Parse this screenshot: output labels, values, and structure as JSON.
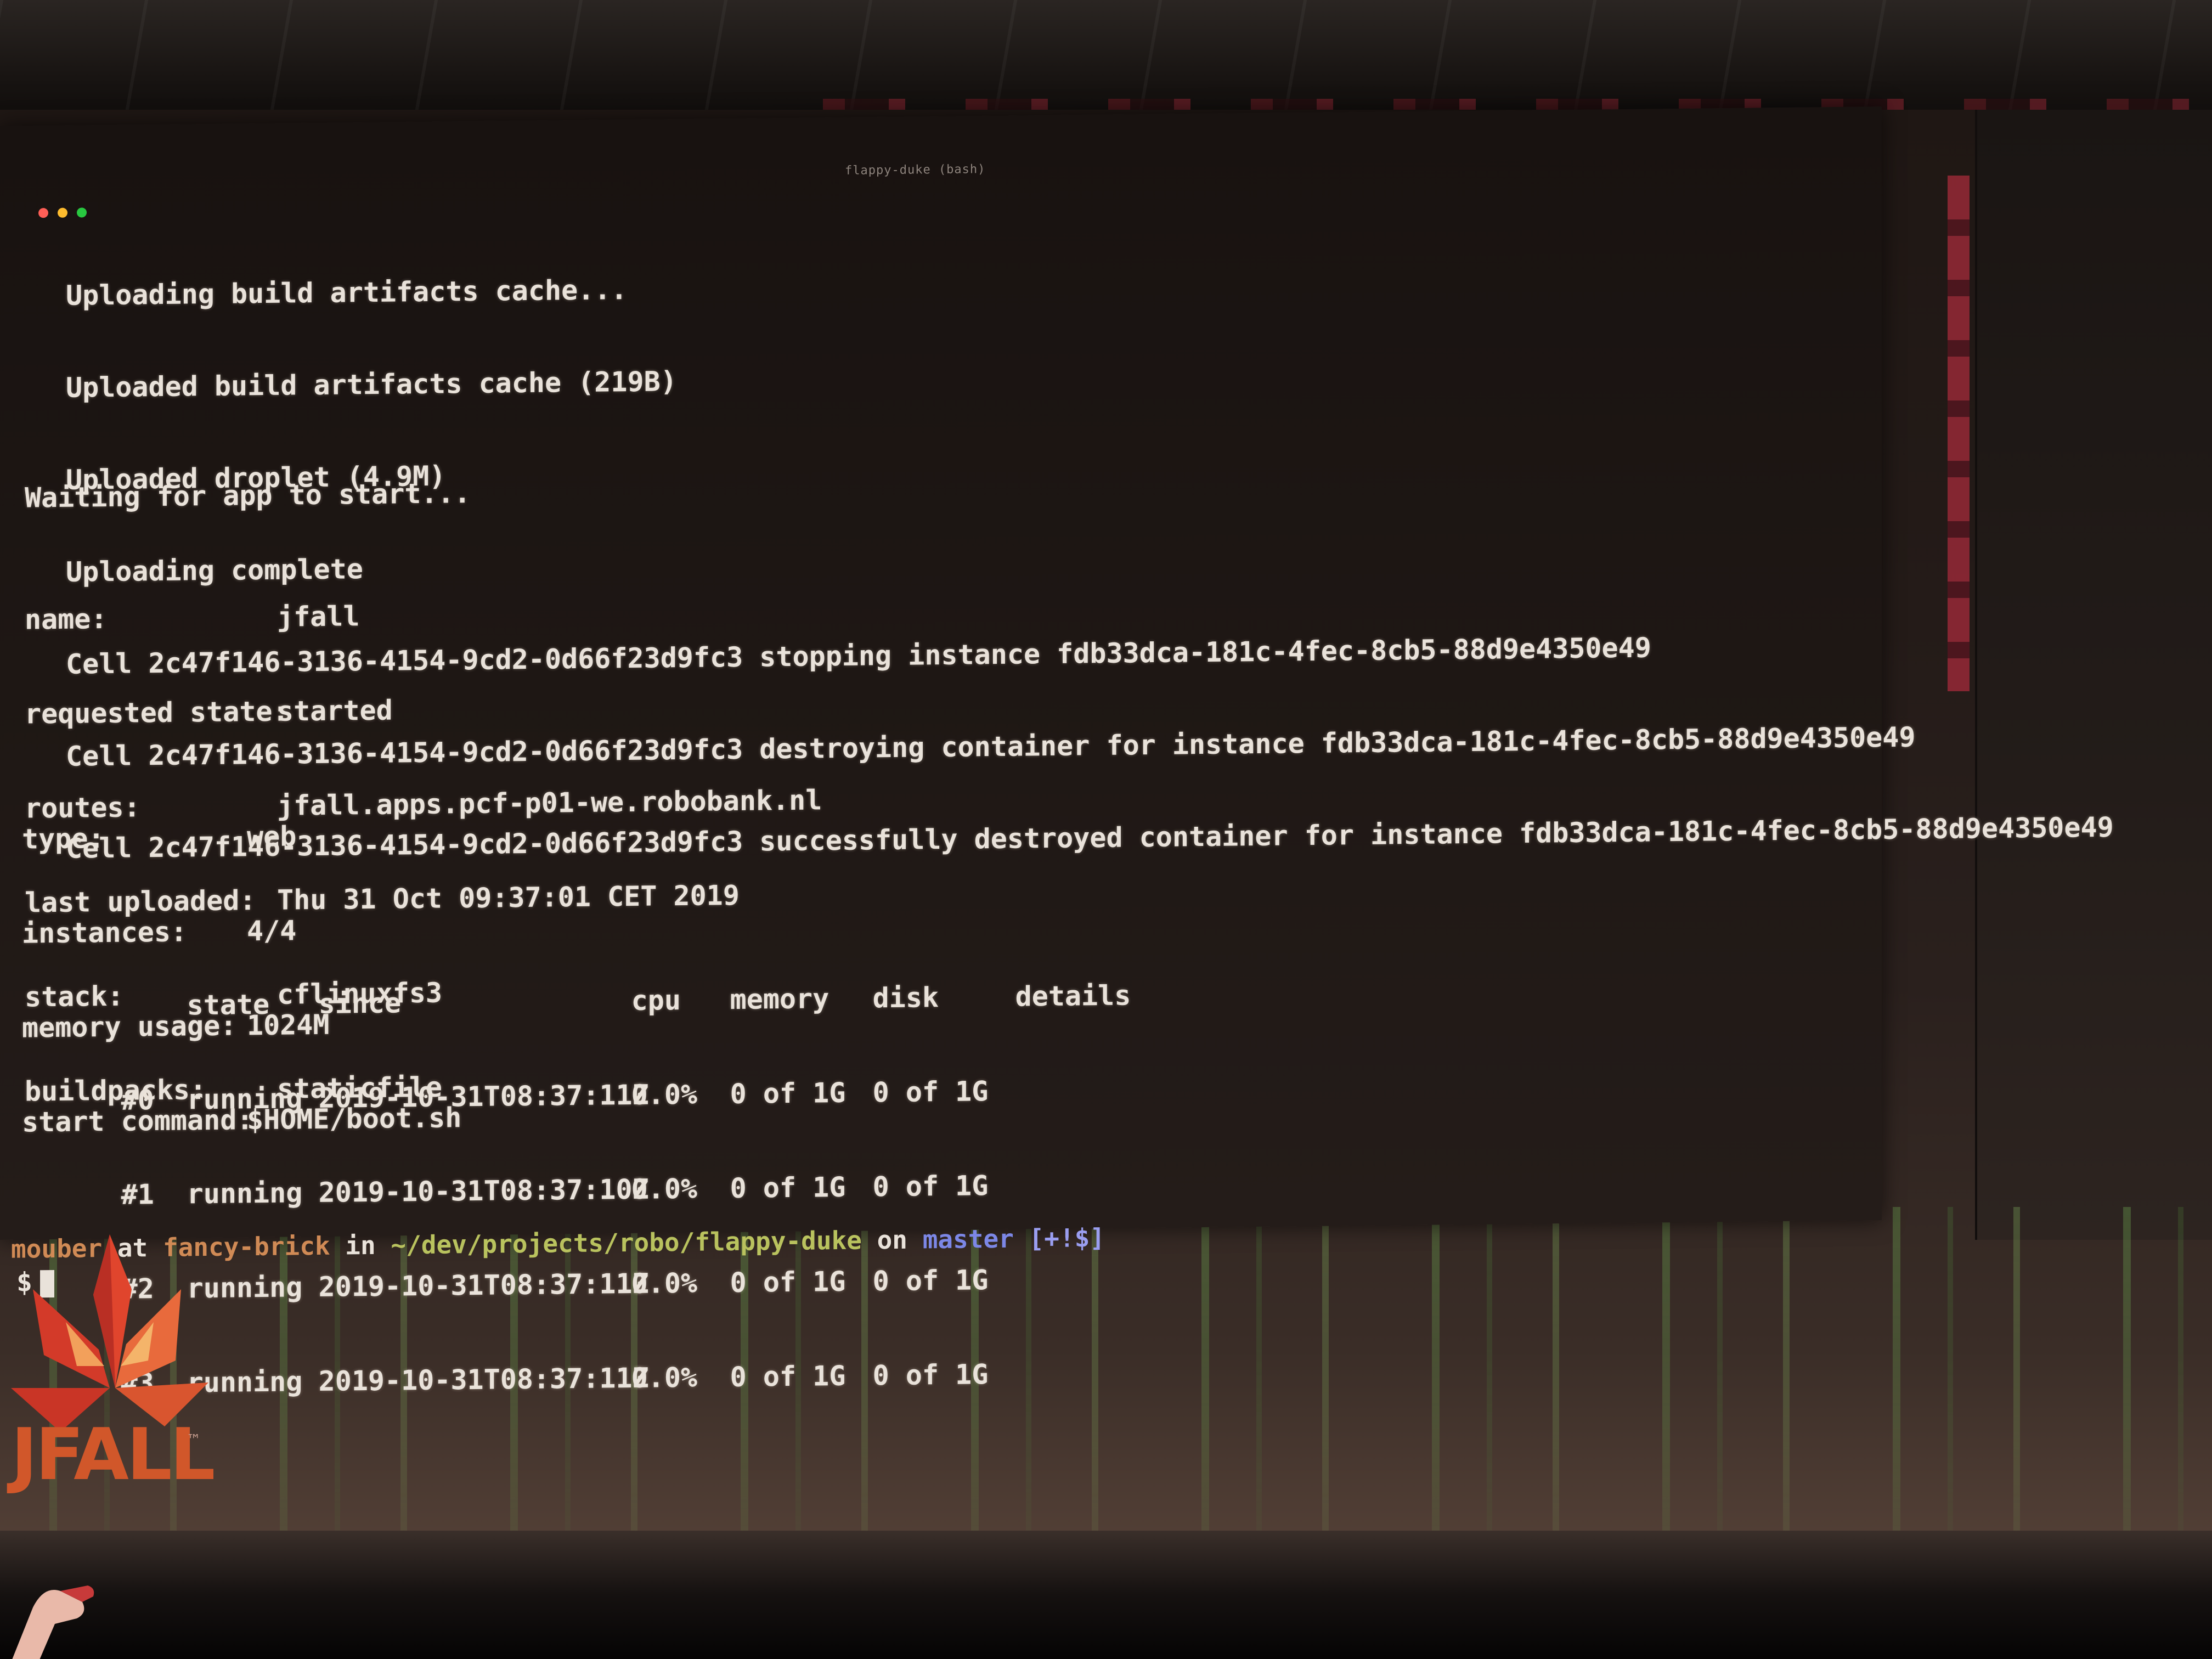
{
  "window": {
    "title": "flappy-duke (bash)",
    "traffic_colors": [
      "#ff5f57",
      "#febc2e",
      "#28c840"
    ]
  },
  "log": [
    "Uploading build artifacts cache...",
    "Uploaded build artifacts cache (219B)",
    "Uploaded droplet (4.9M)",
    "Uploading complete",
    "Cell 2c47f146-3136-4154-9cd2-0d66f23d9fc3 stopping instance fdb33dca-181c-4fec-8cb5-88d9e4350e49",
    "Cell 2c47f146-3136-4154-9cd2-0d66f23d9fc3 destroying container for instance fdb33dca-181c-4fec-8cb5-88d9e4350e49",
    "Cell 2c47f146-3136-4154-9cd2-0d66f23d9fc3 successfully destroyed container for instance fdb33dca-181c-4fec-8cb5-88d9e4350e49"
  ],
  "waiting": "Waiting for app to start...",
  "app": {
    "name_label": "name:",
    "name": "jfall",
    "requested_state_label": "requested state:",
    "requested_state": "started",
    "routes_label": "routes:",
    "routes": "jfall.apps.pcf-p01-we.robobank.nl",
    "last_uploaded_label": "last uploaded:",
    "last_uploaded": "Thu 31 Oct 09:37:01 CET 2019",
    "stack_label": "stack:",
    "stack": "cflinuxfs3",
    "buildpacks_label": "buildpacks:",
    "buildpacks": "staticfile"
  },
  "process": {
    "type_label": "type:",
    "type": "web",
    "instances_label": "instances:",
    "instances": "4/4",
    "memory_usage_label": "memory usage:",
    "memory_usage": "1024M",
    "start_command_label": "start command:",
    "start_command": "$HOME/boot.sh"
  },
  "table": {
    "headers": [
      "",
      "state",
      "since",
      "cpu",
      "memory",
      "disk",
      "details"
    ],
    "rows": [
      [
        "#0",
        "running",
        "2019-10-31T08:37:11Z",
        "0.0%",
        "0 of 1G",
        "0 of 1G",
        ""
      ],
      [
        "#1",
        "running",
        "2019-10-31T08:37:10Z",
        "0.0%",
        "0 of 1G",
        "0 of 1G",
        ""
      ],
      [
        "#2",
        "running",
        "2019-10-31T08:37:11Z",
        "0.0%",
        "0 of 1G",
        "0 of 1G",
        ""
      ],
      [
        "#3",
        "running",
        "2019-10-31T08:37:11Z",
        "0.0%",
        "0 of 1G",
        "0 of 1G",
        ""
      ]
    ]
  },
  "prompt": {
    "user": "mouber",
    "at": " at ",
    "host": "fancy-brick",
    "in": " in ",
    "path": "~/dev/projects/robo/flappy-duke",
    "on": " on ",
    "branch": "master",
    "status": " [+!$]",
    "symbol": "$"
  },
  "logo": {
    "text": "JFALL",
    "tm": "™"
  }
}
